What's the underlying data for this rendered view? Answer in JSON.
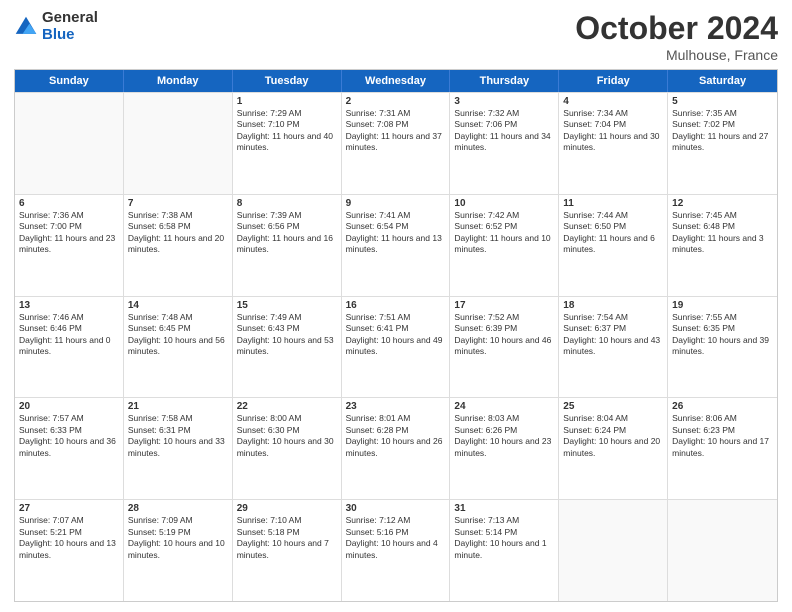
{
  "header": {
    "logo_general": "General",
    "logo_blue": "Blue",
    "month_title": "October 2024",
    "subtitle": "Mulhouse, France"
  },
  "days_of_week": [
    "Sunday",
    "Monday",
    "Tuesday",
    "Wednesday",
    "Thursday",
    "Friday",
    "Saturday"
  ],
  "weeks": [
    [
      {
        "day": "",
        "empty": true,
        "sunrise": "",
        "sunset": "",
        "daylight": ""
      },
      {
        "day": "",
        "empty": true,
        "sunrise": "",
        "sunset": "",
        "daylight": ""
      },
      {
        "day": "1",
        "empty": false,
        "sunrise": "Sunrise: 7:29 AM",
        "sunset": "Sunset: 7:10 PM",
        "daylight": "Daylight: 11 hours and 40 minutes."
      },
      {
        "day": "2",
        "empty": false,
        "sunrise": "Sunrise: 7:31 AM",
        "sunset": "Sunset: 7:08 PM",
        "daylight": "Daylight: 11 hours and 37 minutes."
      },
      {
        "day": "3",
        "empty": false,
        "sunrise": "Sunrise: 7:32 AM",
        "sunset": "Sunset: 7:06 PM",
        "daylight": "Daylight: 11 hours and 34 minutes."
      },
      {
        "day": "4",
        "empty": false,
        "sunrise": "Sunrise: 7:34 AM",
        "sunset": "Sunset: 7:04 PM",
        "daylight": "Daylight: 11 hours and 30 minutes."
      },
      {
        "day": "5",
        "empty": false,
        "sunrise": "Sunrise: 7:35 AM",
        "sunset": "Sunset: 7:02 PM",
        "daylight": "Daylight: 11 hours and 27 minutes."
      }
    ],
    [
      {
        "day": "6",
        "empty": false,
        "sunrise": "Sunrise: 7:36 AM",
        "sunset": "Sunset: 7:00 PM",
        "daylight": "Daylight: 11 hours and 23 minutes."
      },
      {
        "day": "7",
        "empty": false,
        "sunrise": "Sunrise: 7:38 AM",
        "sunset": "Sunset: 6:58 PM",
        "daylight": "Daylight: 11 hours and 20 minutes."
      },
      {
        "day": "8",
        "empty": false,
        "sunrise": "Sunrise: 7:39 AM",
        "sunset": "Sunset: 6:56 PM",
        "daylight": "Daylight: 11 hours and 16 minutes."
      },
      {
        "day": "9",
        "empty": false,
        "sunrise": "Sunrise: 7:41 AM",
        "sunset": "Sunset: 6:54 PM",
        "daylight": "Daylight: 11 hours and 13 minutes."
      },
      {
        "day": "10",
        "empty": false,
        "sunrise": "Sunrise: 7:42 AM",
        "sunset": "Sunset: 6:52 PM",
        "daylight": "Daylight: 11 hours and 10 minutes."
      },
      {
        "day": "11",
        "empty": false,
        "sunrise": "Sunrise: 7:44 AM",
        "sunset": "Sunset: 6:50 PM",
        "daylight": "Daylight: 11 hours and 6 minutes."
      },
      {
        "day": "12",
        "empty": false,
        "sunrise": "Sunrise: 7:45 AM",
        "sunset": "Sunset: 6:48 PM",
        "daylight": "Daylight: 11 hours and 3 minutes."
      }
    ],
    [
      {
        "day": "13",
        "empty": false,
        "sunrise": "Sunrise: 7:46 AM",
        "sunset": "Sunset: 6:46 PM",
        "daylight": "Daylight: 11 hours and 0 minutes."
      },
      {
        "day": "14",
        "empty": false,
        "sunrise": "Sunrise: 7:48 AM",
        "sunset": "Sunset: 6:45 PM",
        "daylight": "Daylight: 10 hours and 56 minutes."
      },
      {
        "day": "15",
        "empty": false,
        "sunrise": "Sunrise: 7:49 AM",
        "sunset": "Sunset: 6:43 PM",
        "daylight": "Daylight: 10 hours and 53 minutes."
      },
      {
        "day": "16",
        "empty": false,
        "sunrise": "Sunrise: 7:51 AM",
        "sunset": "Sunset: 6:41 PM",
        "daylight": "Daylight: 10 hours and 49 minutes."
      },
      {
        "day": "17",
        "empty": false,
        "sunrise": "Sunrise: 7:52 AM",
        "sunset": "Sunset: 6:39 PM",
        "daylight": "Daylight: 10 hours and 46 minutes."
      },
      {
        "day": "18",
        "empty": false,
        "sunrise": "Sunrise: 7:54 AM",
        "sunset": "Sunset: 6:37 PM",
        "daylight": "Daylight: 10 hours and 43 minutes."
      },
      {
        "day": "19",
        "empty": false,
        "sunrise": "Sunrise: 7:55 AM",
        "sunset": "Sunset: 6:35 PM",
        "daylight": "Daylight: 10 hours and 39 minutes."
      }
    ],
    [
      {
        "day": "20",
        "empty": false,
        "sunrise": "Sunrise: 7:57 AM",
        "sunset": "Sunset: 6:33 PM",
        "daylight": "Daylight: 10 hours and 36 minutes."
      },
      {
        "day": "21",
        "empty": false,
        "sunrise": "Sunrise: 7:58 AM",
        "sunset": "Sunset: 6:31 PM",
        "daylight": "Daylight: 10 hours and 33 minutes."
      },
      {
        "day": "22",
        "empty": false,
        "sunrise": "Sunrise: 8:00 AM",
        "sunset": "Sunset: 6:30 PM",
        "daylight": "Daylight: 10 hours and 30 minutes."
      },
      {
        "day": "23",
        "empty": false,
        "sunrise": "Sunrise: 8:01 AM",
        "sunset": "Sunset: 6:28 PM",
        "daylight": "Daylight: 10 hours and 26 minutes."
      },
      {
        "day": "24",
        "empty": false,
        "sunrise": "Sunrise: 8:03 AM",
        "sunset": "Sunset: 6:26 PM",
        "daylight": "Daylight: 10 hours and 23 minutes."
      },
      {
        "day": "25",
        "empty": false,
        "sunrise": "Sunrise: 8:04 AM",
        "sunset": "Sunset: 6:24 PM",
        "daylight": "Daylight: 10 hours and 20 minutes."
      },
      {
        "day": "26",
        "empty": false,
        "sunrise": "Sunrise: 8:06 AM",
        "sunset": "Sunset: 6:23 PM",
        "daylight": "Daylight: 10 hours and 17 minutes."
      }
    ],
    [
      {
        "day": "27",
        "empty": false,
        "sunrise": "Sunrise: 7:07 AM",
        "sunset": "Sunset: 5:21 PM",
        "daylight": "Daylight: 10 hours and 13 minutes."
      },
      {
        "day": "28",
        "empty": false,
        "sunrise": "Sunrise: 7:09 AM",
        "sunset": "Sunset: 5:19 PM",
        "daylight": "Daylight: 10 hours and 10 minutes."
      },
      {
        "day": "29",
        "empty": false,
        "sunrise": "Sunrise: 7:10 AM",
        "sunset": "Sunset: 5:18 PM",
        "daylight": "Daylight: 10 hours and 7 minutes."
      },
      {
        "day": "30",
        "empty": false,
        "sunrise": "Sunrise: 7:12 AM",
        "sunset": "Sunset: 5:16 PM",
        "daylight": "Daylight: 10 hours and 4 minutes."
      },
      {
        "day": "31",
        "empty": false,
        "sunrise": "Sunrise: 7:13 AM",
        "sunset": "Sunset: 5:14 PM",
        "daylight": "Daylight: 10 hours and 1 minute."
      },
      {
        "day": "",
        "empty": true,
        "sunrise": "",
        "sunset": "",
        "daylight": ""
      },
      {
        "day": "",
        "empty": true,
        "sunrise": "",
        "sunset": "",
        "daylight": ""
      }
    ]
  ]
}
